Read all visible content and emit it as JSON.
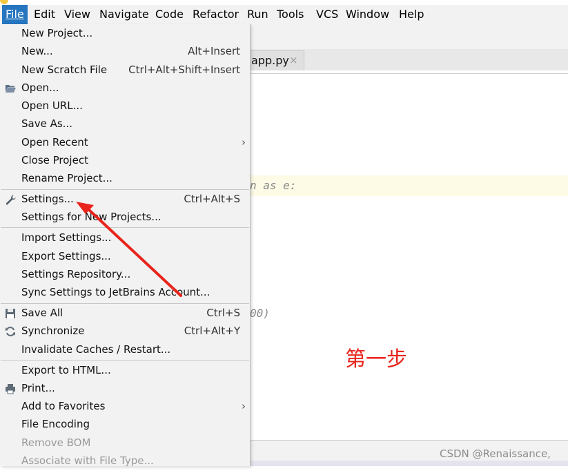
{
  "menubar": {
    "items": [
      "File",
      "Edit",
      "View",
      "Navigate",
      "Code",
      "Refactor",
      "Run",
      "Tools",
      "VCS",
      "Window",
      "Help"
    ],
    "active": "File"
  },
  "editor": {
    "tab_label": "app.py",
    "tab_close": "×",
    "code_fragment_1": "n as e:",
    "code_fragment_2": "00)"
  },
  "file_menu": {
    "items": [
      {
        "label": "New Project...",
        "shortcut": ""
      },
      {
        "label": "New...",
        "shortcut": "Alt+Insert"
      },
      {
        "label": "New Scratch File",
        "shortcut": "Ctrl+Alt+Shift+Insert"
      },
      {
        "label": "Open...",
        "shortcut": "",
        "icon": "folder-open-icon"
      },
      {
        "label": "Open URL...",
        "shortcut": ""
      },
      {
        "label": "Save As...",
        "shortcut": ""
      },
      {
        "label": "Open Recent",
        "shortcut": "",
        "submenu": true
      },
      {
        "label": "Close Project",
        "shortcut": ""
      },
      {
        "label": "Rename Project...",
        "shortcut": ""
      },
      {
        "label": "Settings...",
        "shortcut": "Ctrl+Alt+S",
        "icon": "wrench-icon"
      },
      {
        "label": "Settings for New Projects...",
        "shortcut": ""
      },
      {
        "label": "Import Settings...",
        "shortcut": ""
      },
      {
        "label": "Export Settings...",
        "shortcut": ""
      },
      {
        "label": "Settings Repository...",
        "shortcut": ""
      },
      {
        "label": "Sync Settings to JetBrains Account...",
        "shortcut": ""
      },
      {
        "label": "Save All",
        "shortcut": "Ctrl+S",
        "icon": "floppy-disk-icon"
      },
      {
        "label": "Synchronize",
        "shortcut": "Ctrl+Alt+Y",
        "icon": "sync-icon"
      },
      {
        "label": "Invalidate Caches / Restart...",
        "shortcut": ""
      },
      {
        "label": "Export to HTML...",
        "shortcut": ""
      },
      {
        "label": "Print...",
        "shortcut": "",
        "icon": "printer-icon"
      },
      {
        "label": "Add to Favorites",
        "shortcut": "",
        "submenu": true
      },
      {
        "label": "File Encoding",
        "shortcut": ""
      },
      {
        "label": "Remove BOM",
        "shortcut": "",
        "disabled": true
      },
      {
        "label": "Associate with File Type...",
        "shortcut": "",
        "disabled": true
      }
    ],
    "submenu_arrow": "›"
  },
  "annotation": {
    "step_text": "第一步",
    "arrow_color": "#e8241c"
  },
  "watermark": "CSDN @Renaissance,",
  "colors": {
    "accent": "#2675bf",
    "menu_bg": "#f2f2f2",
    "highlight_line": "#fdfbe6"
  }
}
